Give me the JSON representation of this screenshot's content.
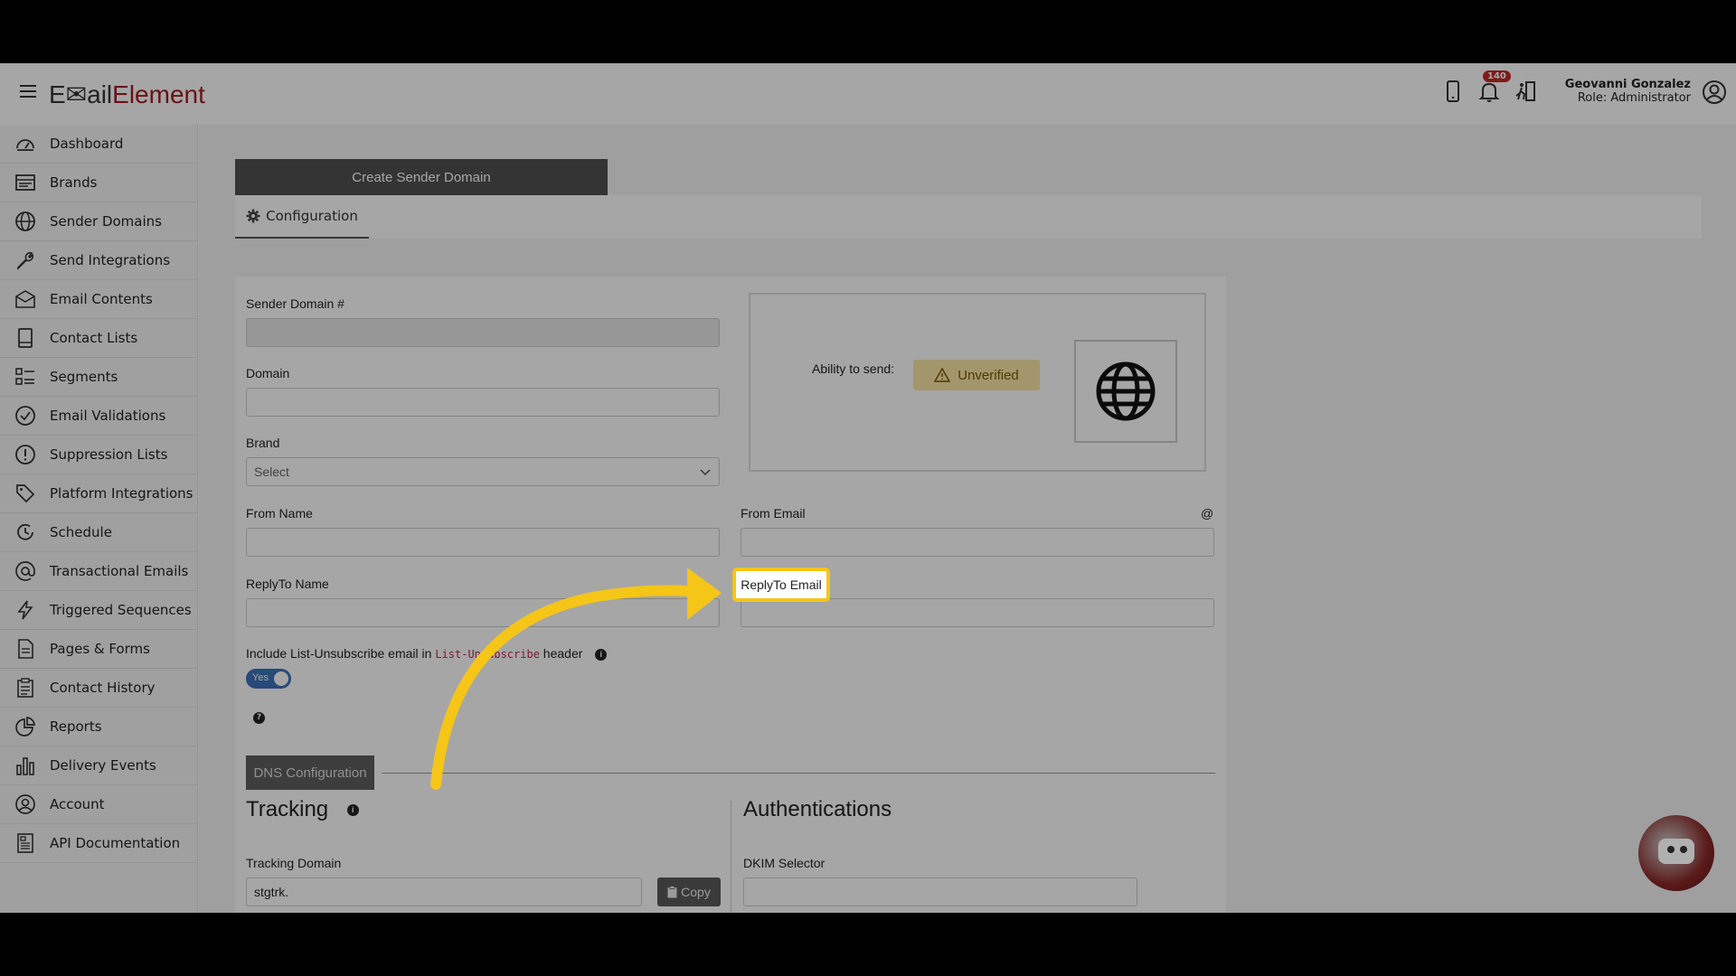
{
  "app": {
    "logo_part1": "E✉ail",
    "logo_part2": "Element",
    "notification_count": "140",
    "user_name": "Geovanni Gonzalez",
    "user_role": "Role: Administrator"
  },
  "sidebar": {
    "items": [
      {
        "label": "Dashboard",
        "icon": "dashboard-icon"
      },
      {
        "label": "Brands",
        "icon": "brands-icon"
      },
      {
        "label": "Sender Domains",
        "icon": "globe-icon"
      },
      {
        "label": "Send Integrations",
        "icon": "wrench-icon"
      },
      {
        "label": "Email Contents",
        "icon": "envelope-icon"
      },
      {
        "label": "Contact Lists",
        "icon": "book-icon"
      },
      {
        "label": "Segments",
        "icon": "segments-icon"
      },
      {
        "label": "Email Validations",
        "icon": "check-circle-icon"
      },
      {
        "label": "Suppression Lists",
        "icon": "exclamation-circle-icon"
      },
      {
        "label": "Platform Integrations",
        "icon": "tag-icon"
      },
      {
        "label": "Schedule",
        "icon": "clock-icon"
      },
      {
        "label": "Transactional Emails",
        "icon": "at-icon"
      },
      {
        "label": "Triggered Sequences",
        "icon": "lightning-icon"
      },
      {
        "label": "Pages & Forms",
        "icon": "page-icon"
      },
      {
        "label": "Contact History",
        "icon": "clipboard-icon"
      },
      {
        "label": "Reports",
        "icon": "pie-chart-icon"
      },
      {
        "label": "Delivery Events",
        "icon": "bar-chart-icon"
      },
      {
        "label": "Account",
        "icon": "user-circle-icon"
      },
      {
        "label": "API Documentation",
        "icon": "document-icon"
      }
    ]
  },
  "main": {
    "create_tab": "Create Sender Domain",
    "config_tab": "Configuration",
    "sender_domain_label": "Sender Domain #",
    "domain_label": "Domain",
    "brand_label": "Brand",
    "brand_select": "Select",
    "from_name_label": "From Name",
    "from_email_label": "From Email",
    "at_sign": "@",
    "replyto_name_label": "ReplyTo Name",
    "replyto_email_label": "ReplyTo Email",
    "unsub_text_before": "Include List-Unsubscribe email in ",
    "unsub_code": "List-Unsubscribe",
    "unsub_text_after": " header",
    "toggle_label": "Yes",
    "ability_label": "Ability to send:",
    "status": "Unverified",
    "dns_button": "DNS Configuration",
    "tracking_title": "Tracking",
    "tracking_domain_label": "Tracking Domain",
    "tracking_domain_value": "stgtrk.",
    "copy_button": "Copy",
    "auth_title": "Authentications",
    "dkim_label": "DKIM Selector"
  },
  "colors": {
    "accent": "#3d72b8",
    "brand_red": "#a11d21",
    "highlight": "#f5c518",
    "badge": "#c62828"
  }
}
